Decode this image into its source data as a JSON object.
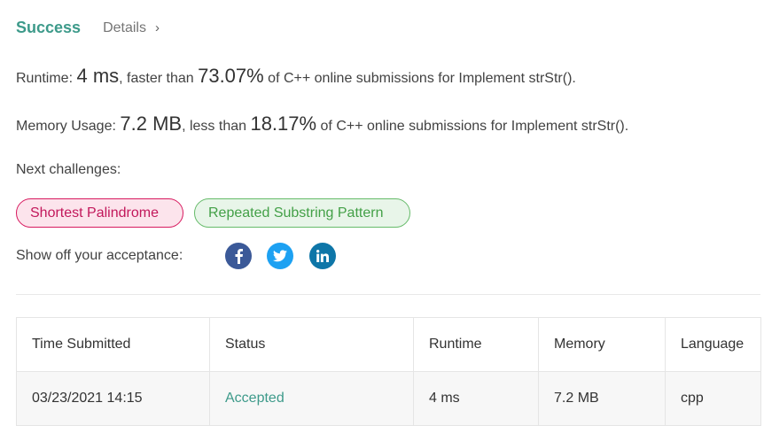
{
  "header": {
    "status": "Success",
    "details_label": "Details",
    "details_chevron": "›"
  },
  "runtime": {
    "label": "Runtime: ",
    "value": "4 ms",
    "comparison": ", faster than ",
    "percent": "73.07%",
    "suffix": " of C++ online submissions for Implement strStr()."
  },
  "memory": {
    "label": "Memory Usage: ",
    "value": "7.2 MB",
    "comparison": ", less than ",
    "percent": "18.17%",
    "suffix": " of C++ online submissions for Implement strStr()."
  },
  "next_challenges": {
    "label": "Next challenges:",
    "items": [
      {
        "label": "Shortest Palindrome",
        "difficulty": "hard",
        "color": "#c2185b"
      },
      {
        "label": "Repeated Substring Pattern",
        "difficulty": "medium",
        "color": "#43a047"
      }
    ]
  },
  "share": {
    "label": "Show off your acceptance:",
    "icons": [
      "facebook-icon",
      "twitter-icon",
      "linkedin-icon"
    ]
  },
  "submissions": {
    "columns": [
      "Time Submitted",
      "Status",
      "Runtime",
      "Memory",
      "Language"
    ],
    "rows": [
      {
        "time": "03/23/2021 14:15",
        "status": "Accepted",
        "runtime": "4 ms",
        "memory": "7.2 MB",
        "language": "cpp"
      }
    ]
  },
  "colors": {
    "accent": "#3d9a8a",
    "facebook": "#3b5998",
    "twitter": "#1da1f2",
    "linkedin": "#0e76a8"
  }
}
